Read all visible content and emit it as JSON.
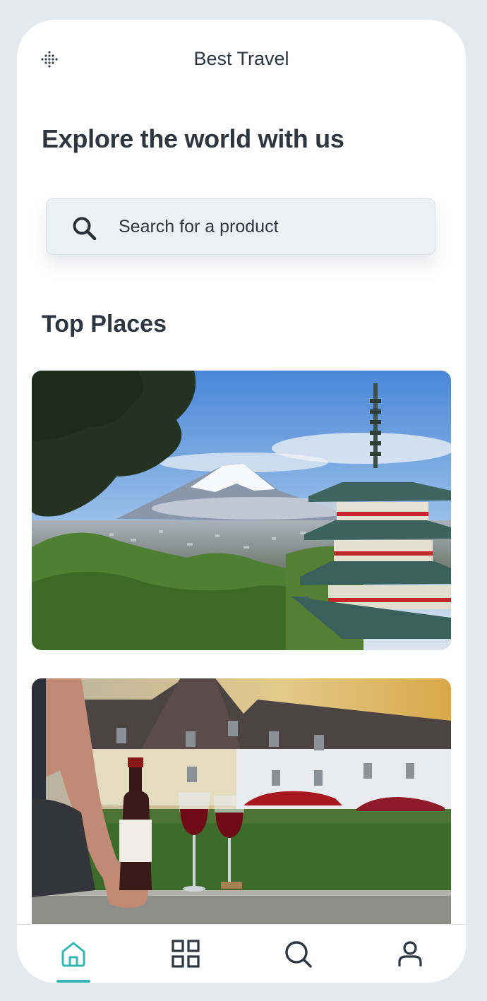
{
  "header": {
    "title": "Best Travel",
    "menu_icon": "dots-grid-icon"
  },
  "hero": {
    "headline": "Explore the world with us"
  },
  "search": {
    "placeholder": "Search for a product",
    "value": "",
    "icon": "search-icon"
  },
  "top_places": {
    "title": "Top Places",
    "cards": [
      {
        "subject": "mount-fuji-pagoda-photo"
      },
      {
        "subject": "wine-tasting-chateau-photo"
      }
    ]
  },
  "tabbar": {
    "tabs": [
      {
        "icon": "home-icon",
        "active": true
      },
      {
        "icon": "grid-icon",
        "active": false
      },
      {
        "icon": "search-icon",
        "active": false
      },
      {
        "icon": "user-icon",
        "active": false
      }
    ],
    "accent_color": "#33b7b1"
  },
  "colors": {
    "background": "#e5e9ee",
    "surface": "#ffffff",
    "text": "#2f3640",
    "search_field": "#edf1f5",
    "accent": "#33b7b1"
  }
}
